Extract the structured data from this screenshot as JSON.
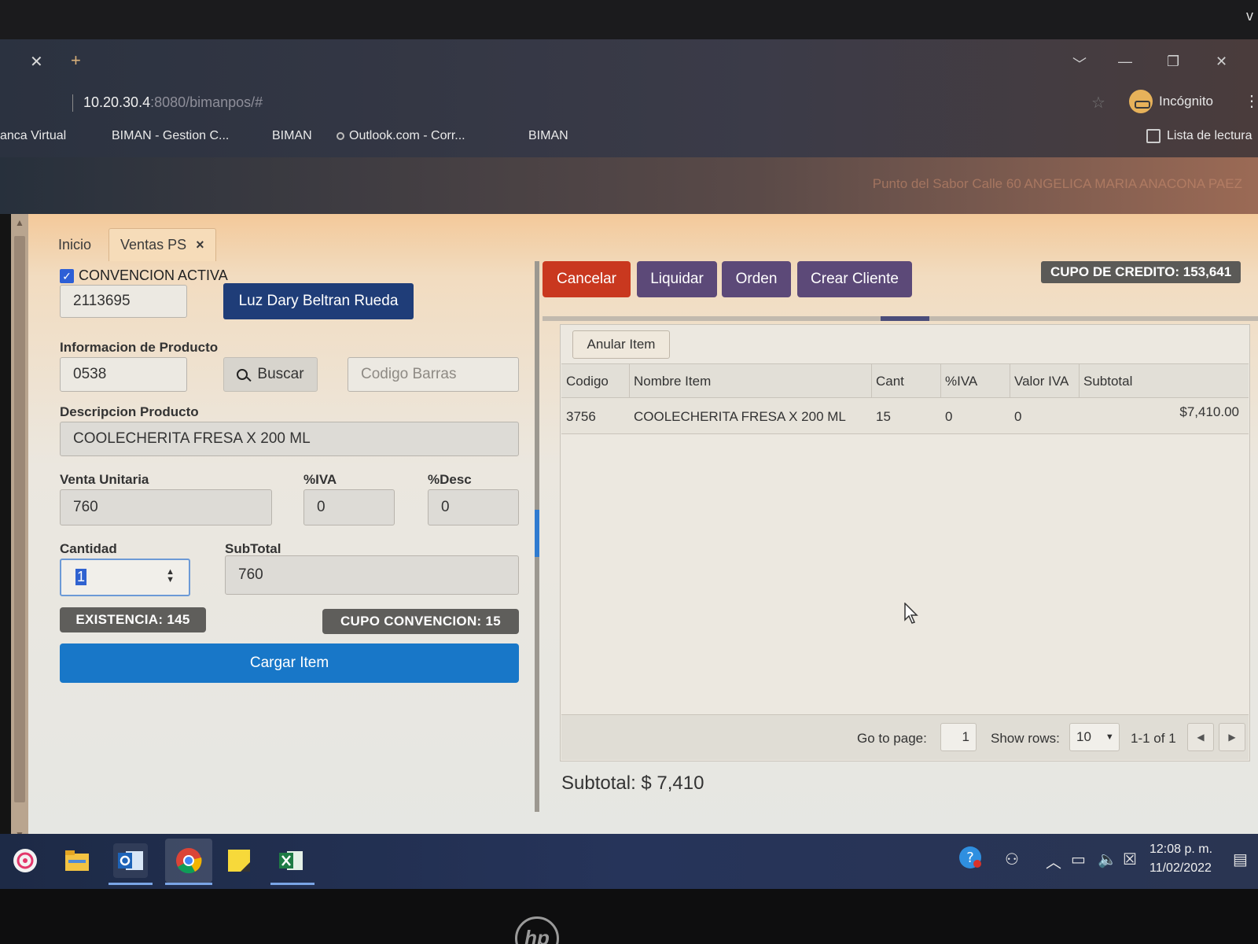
{
  "browser": {
    "url_host": "10.20.30.4",
    "url_rest": ":8080/bimanpos/#",
    "incognito_label": "Incógnito",
    "bookmarks": [
      "anca Virtual",
      "BIMAN - Gestion C...",
      "BIMAN",
      "Outlook.com - Corr...",
      "BIMAN"
    ],
    "reading_list": "Lista de lectura"
  },
  "header": {
    "user_info": "Punto del Sabor Calle 60 ANGELICA MARIA ANACONA PAEZ"
  },
  "tabs": {
    "home": "Inicio",
    "active": "Ventas PS",
    "close_glyph": "×"
  },
  "form": {
    "convention_checkbox": "CONVENCION ACTIVA",
    "client_id": "2113695",
    "client_name_button": "Luz Dary Beltran Rueda",
    "product_info_label": "Informacion de Producto",
    "product_code": "0538",
    "search_button": "Buscar",
    "barcode_placeholder": "Codigo Barras",
    "description_label": "Descripcion Producto",
    "description_value": "COOLECHERITA FRESA X 200 ML",
    "unit_price_label": "Venta Unitaria",
    "unit_price_value": "760",
    "iva_label": "%IVA",
    "iva_value": "0",
    "desc_label": "%Desc",
    "desc_value": "0",
    "quantity_label": "Cantidad",
    "quantity_value": "1",
    "subtotal_label": "SubTotal",
    "subtotal_value": "760",
    "stock_badge": "EXISTENCIA: 145",
    "convention_quota_badge": "CUPO CONVENCION: 15",
    "load_button": "Cargar Item"
  },
  "actions": {
    "cancel": "Cancelar",
    "liquidate": "Liquidar",
    "order": "Orden",
    "create_client": "Crear Cliente",
    "credit_quota": "CUPO DE CREDITO: 153,641"
  },
  "grid": {
    "void_item_button": "Anular Item",
    "columns": [
      "Codigo",
      "Nombre Item",
      "Cant",
      "%IVA",
      "Valor IVA",
      "Subtotal"
    ],
    "rows": [
      {
        "code": "3756",
        "name": "COOLECHERITA FRESA X 200 ML",
        "qty": "15",
        "iva": "0",
        "iva_value": "0",
        "subtotal": "$7,410.00"
      }
    ],
    "pager": {
      "goto_label": "Go to page:",
      "page": "1",
      "show_rows_label": "Show rows:",
      "rows_per_page": "10",
      "range": "1-1 of 1"
    },
    "subtotal_text": "Subtotal: $ 7,410"
  },
  "taskbar": {
    "time": "12:08 p. m.",
    "date": "11/02/2022"
  },
  "colors": {
    "cancel_red": "#c9381f",
    "action_purple": "#5c4978",
    "primary_blue": "#1877c8",
    "client_navy": "#1f3d78",
    "badge_grey": "#5f5e5b"
  }
}
